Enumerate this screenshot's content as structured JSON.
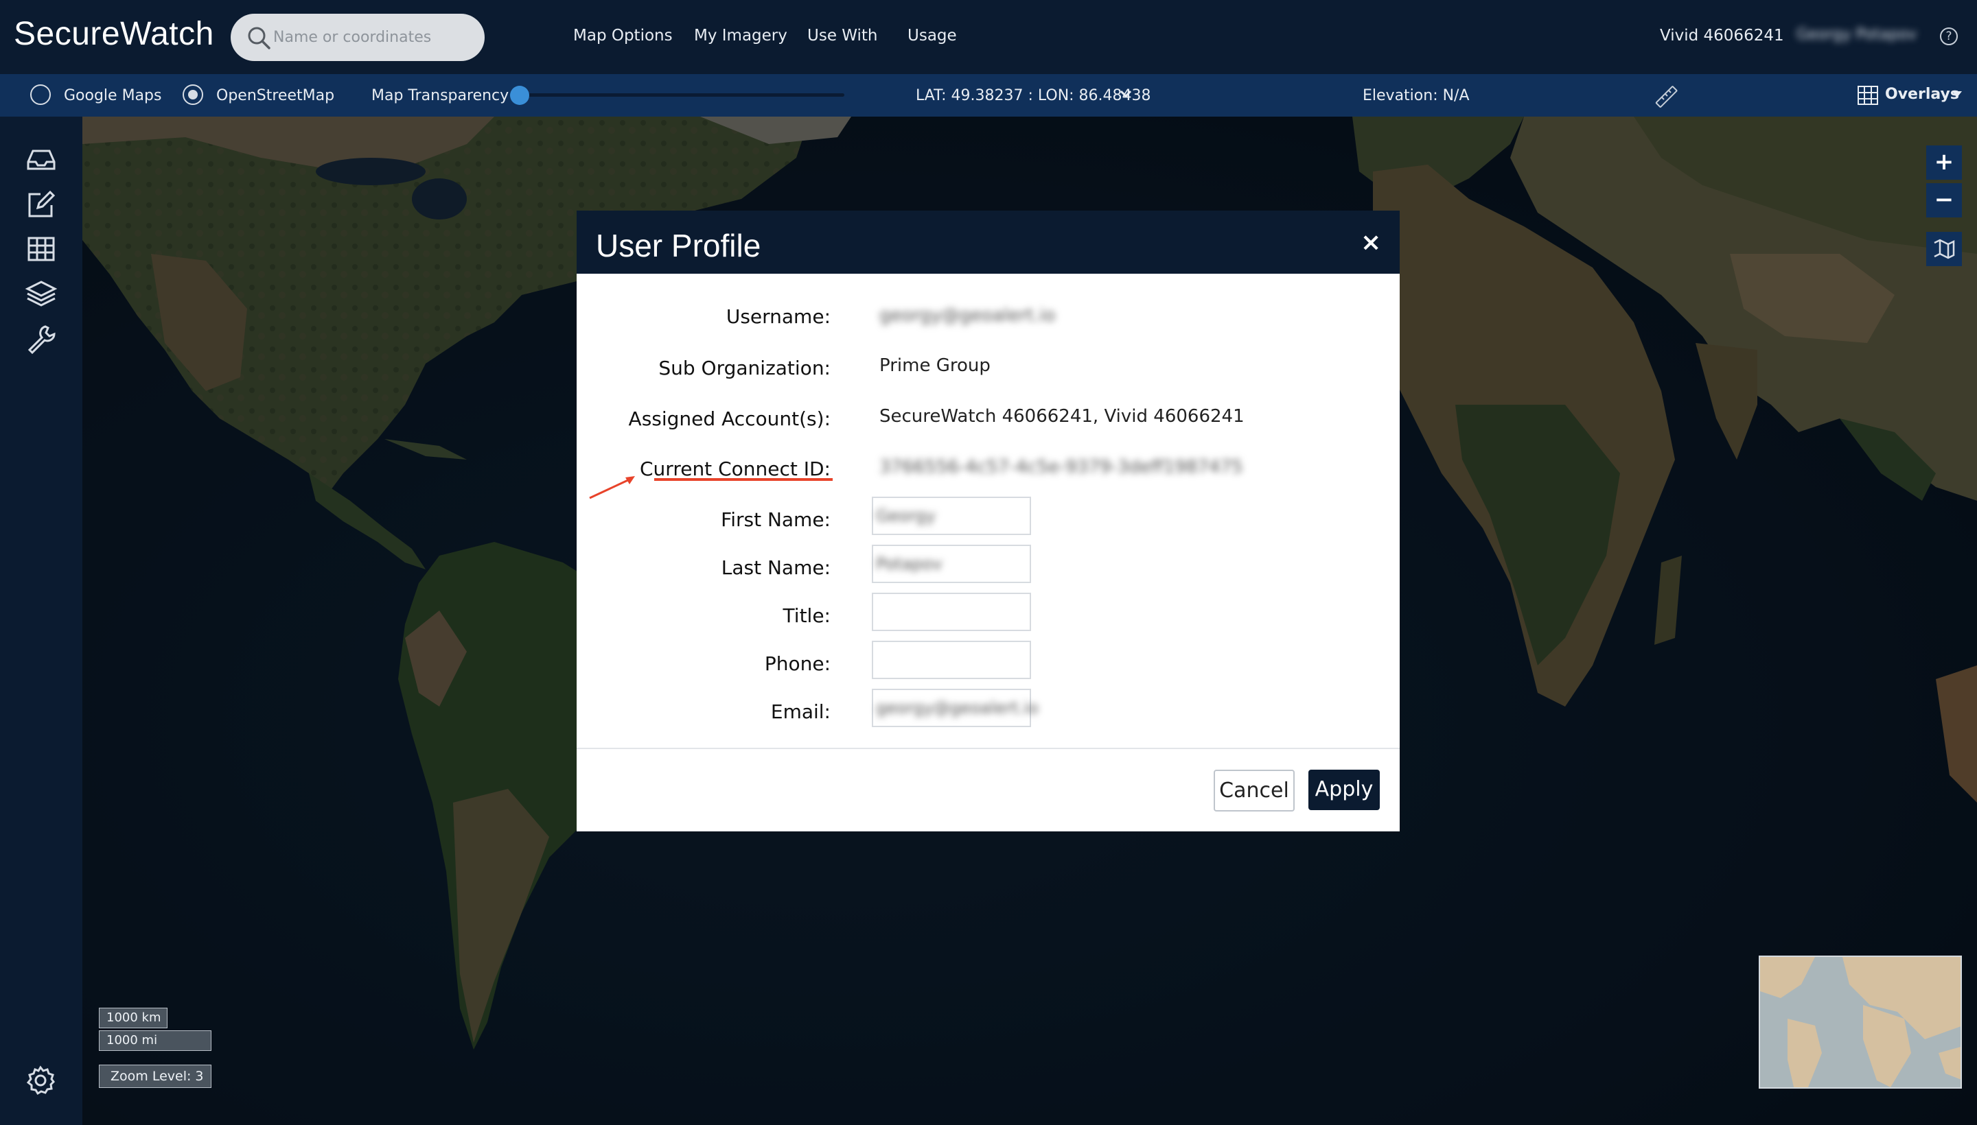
{
  "app": {
    "title": "SecureWatch"
  },
  "search": {
    "placeholder": "Name or coordinates"
  },
  "nav": {
    "items": [
      "Map Options",
      "My Imagery",
      "Use With",
      "Usage"
    ]
  },
  "account": {
    "label": "Vivid 46066241",
    "user_name": "Georgy Potapov"
  },
  "toolbar": {
    "basemaps": [
      {
        "label": "Google Maps",
        "selected": false
      },
      {
        "label": "OpenStreetMap",
        "selected": true
      }
    ],
    "transparency_label": "Map Transparency",
    "transparency_value": 0.0,
    "coordinates": "LAT: 49.38237 : LON: 86.48438",
    "elevation": "Elevation: N/A",
    "overlays_label": "Overlays"
  },
  "map": {
    "scale_km": "1000 km",
    "scale_mi": "1000 mi",
    "zoom_level": "Zoom Level: 3",
    "zoom_in": "+",
    "zoom_out": "−"
  },
  "modal": {
    "title": "User Profile",
    "close": "×",
    "rows": [
      {
        "label": "Username:",
        "value": "georgy@geoalert.io",
        "blurred": true
      },
      {
        "label": "Sub Organization:",
        "value": "Prime Group",
        "blurred": false
      },
      {
        "label": "Assigned Account(s):",
        "value": "SecureWatch 46066241, Vivid 46066241",
        "blurred": false
      },
      {
        "label": "Current Connect ID:",
        "value": "3766556-4c57-4c5e-9379-3deff1987475",
        "blurred": true
      }
    ],
    "fields": [
      {
        "label": "First Name:",
        "value": "Georgy"
      },
      {
        "label": "Last Name:",
        "value": "Potapov"
      },
      {
        "label": "Title:",
        "value": ""
      },
      {
        "label": "Phone:",
        "value": ""
      },
      {
        "label": "Email:",
        "value": "georgy@geoalert.io"
      }
    ],
    "cancel_label": "Cancel",
    "apply_label": "Apply"
  },
  "colors": {
    "brand_navy": "#0b1b30",
    "toolbar_blue": "#10305a",
    "annotation_red": "#e8432a",
    "slider_blue": "#3a8fd8"
  }
}
